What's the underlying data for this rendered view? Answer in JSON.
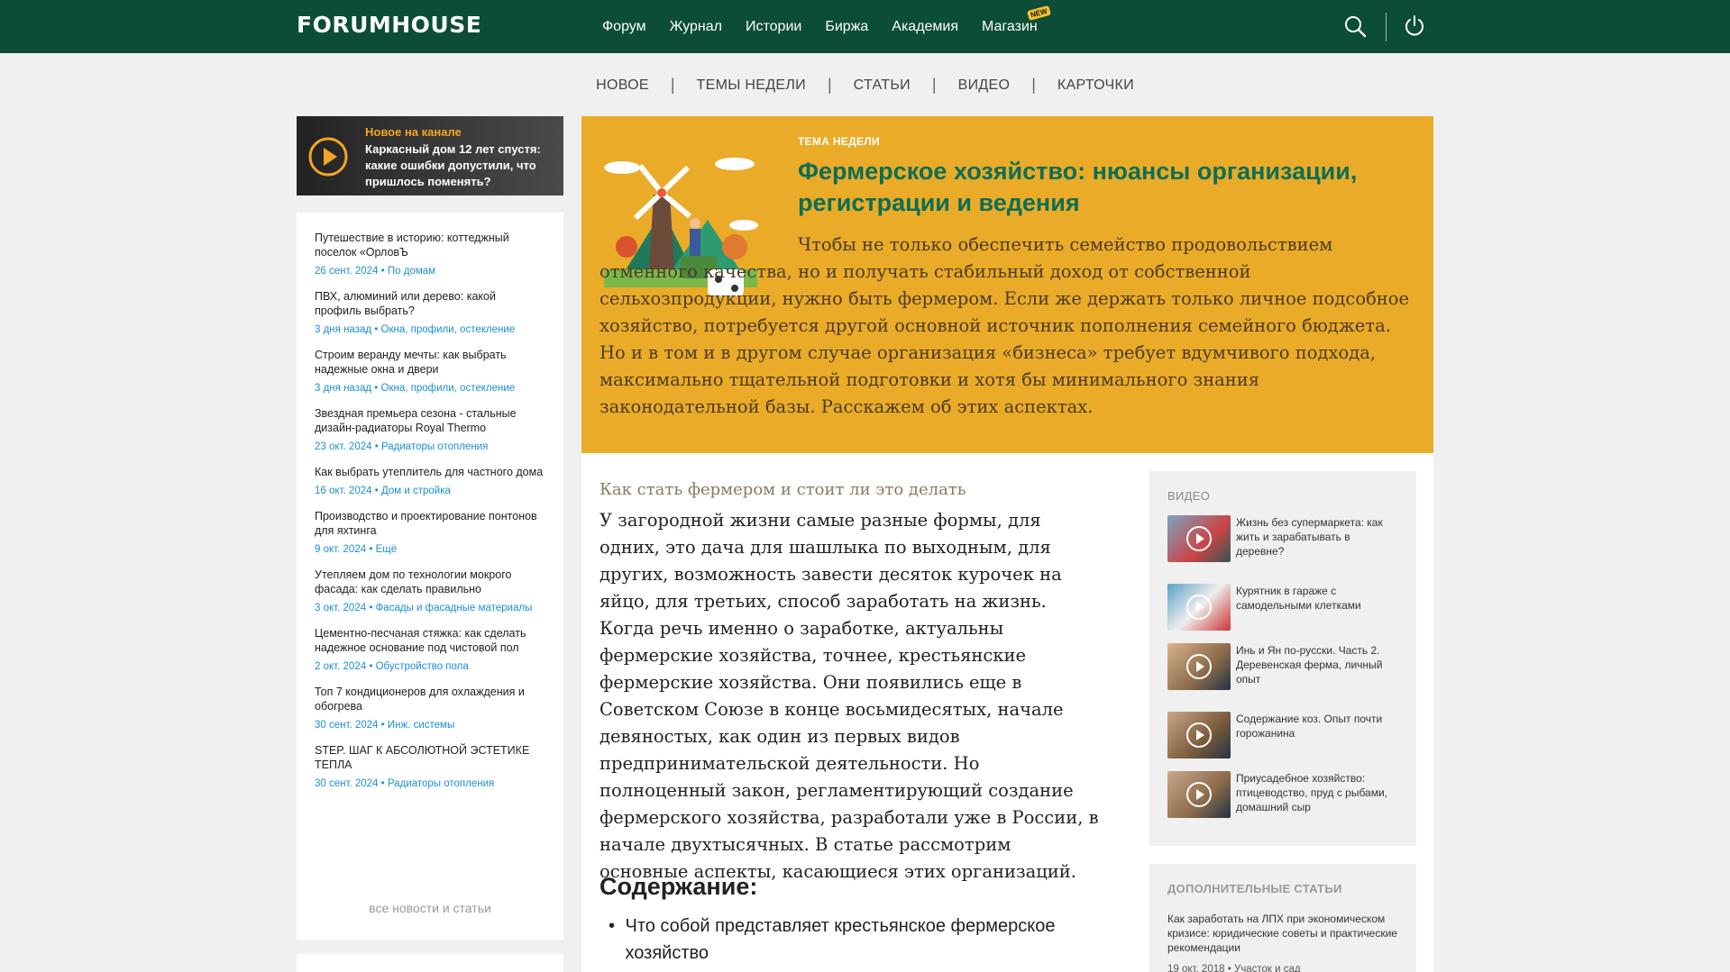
{
  "header": {
    "logo": "FORUMHOUSE",
    "nav": [
      "Форум",
      "Журнал",
      "Истории",
      "Биржа",
      "Академия",
      "Магазин"
    ],
    "new_badge": "NEW",
    "icons": [
      "search-icon",
      "power-icon"
    ],
    "bg_color": "#0b4d36"
  },
  "subnav": [
    "НОВОЕ",
    "ТЕМЫ НЕДЕЛИ",
    "СТАТЬИ",
    "ВИДЕО",
    "КАРТОЧКИ"
  ],
  "promo": {
    "kicker": "Новое на канале",
    "title": "Каркасный дом 12 лет спустя: какие ошибки допустили, что пришлось поменять?"
  },
  "news": {
    "items": [
      {
        "title": "Путешествие в историю: коттеджный поселок «ОрловЪ",
        "date": "26 сент. 2024",
        "category": "По домам"
      },
      {
        "title": "ПВХ, алюминий или дерево: какой профиль выбрать?",
        "date": "3 дня назад",
        "category": "Окна, профили, остекление"
      },
      {
        "title": "Строим веранду мечты: как выбрать надежные окна и двери",
        "date": "3 дня назад",
        "category": "Окна, профили, остекление"
      },
      {
        "title": "Звездная премьера сезона - стальные дизайн-радиаторы Royal Thermo",
        "date": "23 окт. 2024",
        "category": "Радиаторы отопления"
      },
      {
        "title": "Как выбрать утеплитель для частного дома",
        "date": "16 окт. 2024",
        "category": "Дом и стройка"
      },
      {
        "title": "Производство и проектирование понтонов для яхтинга",
        "date": "9 окт. 2024",
        "category": "Ещё"
      },
      {
        "title": "Утепляем дом по технологии мокрого фасада: как сделать правильно",
        "date": "3 окт. 2024",
        "category": "Фасады и фасадные материалы"
      },
      {
        "title": "Цементно-песчаная стяжка: как сделать надежное основание под чистовой пол",
        "date": "2 окт. 2024",
        "category": "Обустройство пола"
      },
      {
        "title": "Топ 7 кондиционеров для охлаждения и обогрева",
        "date": "30 сент. 2024",
        "category": "Инж. системы"
      },
      {
        "title": "STEP. ШАГ К АБСОЛЮТНОЙ ЭСТЕТИКЕ ТЕПЛА",
        "date": "30 сент. 2024",
        "category": "Радиаторы отопления"
      }
    ],
    "separator": "•",
    "more": "все новости и статьи"
  },
  "feature": {
    "kicker": "ТЕМА НЕДЕЛИ",
    "title": "Фермерское хозяйство: нюансы организации, регистрации и ведения",
    "text": "Чтобы не только обеспечить семейство продовольствием отменного качества, но и получать стабильный доход от собственной сельхозпродукции, нужно быть фермером. Если же держать только личное подсобное хозяйство, потребуется другой основной источник пополнения семейного бюджета. Но и в том и в другом случае организация «бизнеса» требует вдумчивого подхода, максимально тщательной подготовки и хотя бы минимального знания законодательной базы. Расскажем об этих аспектах.",
    "bg_color": "#eaab29",
    "title_color": "#0d6e54"
  },
  "article": {
    "subtitle": "Как стать фермером и стоит ли это делать",
    "body": "У загородной жизни самые разные формы, для одних, это дача для шашлыка по выходным, для других, возможность завести десяток курочек на яйцо, для третьих, способ заработать на жизнь. Когда речь именно о заработке, актуальны фермерские хозяйства, точнее, крестьянские фермерские хозяйства. Они появились еще в Советском Союзе в конце восьмидесятых, начале девяностых, как один из первых видов предпринимательской деятельности. Но полноценный закон, регламентирующий создание фермерского хозяйства, разработали уже в России, в начале двухтысячных. В статье рассмотрим основные аспекты, касающиеся этих организаций.",
    "toc_heading": "Содержание:",
    "toc": [
      "Что собой представляет крестьянское фермерское хозяйство"
    ]
  },
  "videos": {
    "heading": "ВИДЕО",
    "items": [
      {
        "title": "Жизнь без супермаркета: как жить и зарабатывать в деревне?"
      },
      {
        "title": "Курятник в гараже с самодельными клетками"
      },
      {
        "title": "Инь и Ян по-русски. Часть 2. Деревенская ферма, личный опыт"
      },
      {
        "title": "Содержание коз. Опыт почти горожанина"
      },
      {
        "title": "Приусадебное хозяйство: птицеводство, пруд с рыбами, домашний сыр"
      }
    ]
  },
  "more_articles": {
    "heading": "ДОПОЛНИТЕЛЬНЫЕ СТАТЬИ",
    "items": [
      {
        "title": "Как заработать на ЛПХ при экономическом кризисе: юридические советы и практические рекомендации",
        "date": "19 окт. 2018",
        "category": "Участок и сад"
      }
    ]
  }
}
